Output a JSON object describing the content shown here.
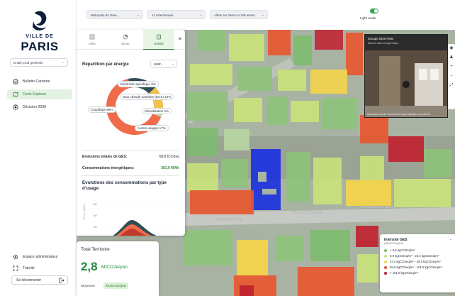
{
  "logo": {
    "line1": "VILLE DE",
    "line2": "PARIS"
  },
  "sidebar": {
    "entity": "Entité prod générale",
    "items": [
      {
        "label": "Bulletin Carbone",
        "icon": "bulletin-icon"
      },
      {
        "label": "Carto Explorer",
        "icon": "map-icon",
        "active": true
      },
      {
        "label": "Décision 2030",
        "icon": "target-icon"
      }
    ],
    "admin": "Espace administrateur",
    "tutorial": "Tutoriel",
    "disconnect": "Se déconnecter"
  },
  "toolbar": {
    "scope": "Métropole du Gran...",
    "selection": "12 sélectionnés",
    "search": "Alban sur Seine et 149 autres",
    "light_mode": "Light mode",
    "light_on": true
  },
  "panel": {
    "tabs": [
      {
        "label": "Infos",
        "icon": "info-icon"
      },
      {
        "label": "Score",
        "icon": "score-icon"
      },
      {
        "label": "Détails",
        "icon": "details-icon",
        "active": true
      }
    ],
    "section_title": "Répartition par énergie",
    "unit": "MWh",
    "donut_labels": {
      "elec": "Electricité spécifique 3%",
      "ecs": "Eau chaude sanitaire (ECS) 14%",
      "chauffage": "Chauffage 66%",
      "clim": "Climatisation 1%",
      "autres": "Autres usages 17%"
    },
    "emissions_label": "Emissions totales de GES:",
    "emissions_value": "68,8 tCO2eq",
    "conso_label": "Consommations énergétiques:",
    "conso_value": "383,9 MWh",
    "evolution_title": "Evolutions des consommations par type d'usage",
    "mini_axis_label": "Conso. (MWh)"
  },
  "chart_data": {
    "type": "pie",
    "title": "Répartition par énergie",
    "categories": [
      "Chauffage",
      "Autres usages",
      "Eau chaude sanitaire (ECS)",
      "Electricité spécifique",
      "Climatisation"
    ],
    "values": [
      66,
      17,
      14,
      3,
      1
    ],
    "unit": "%",
    "colors": [
      "#ef6b4a",
      "#2e4d57",
      "#f2c14e",
      "#7cc38a",
      "#b7d9c0"
    ]
  },
  "mini_chart": {
    "ticks": [
      "60",
      "40",
      "20"
    ]
  },
  "total": {
    "title": "Total Territoire",
    "value": "2,8",
    "unit": "MtCO2eq/an",
    "mean_label": "Moyenne",
    "mean_value": "39,6tCO2eq/an"
  },
  "map": {
    "street1": "Rue Alexandre Parodi",
    "street2": "Rue Alexandre Parodi",
    "street3": "e Alexandre Parodi",
    "streetview": {
      "title": "Groupe GES Paris",
      "subtitle": "Afficher dans Google Maps",
      "footer": "Raccourcis clavier   Données d'images   Signaler un problème"
    },
    "legend": {
      "title": "Intensité GES",
      "subtitle": "(tMtotCO2eq/m²)",
      "rows": [
        {
          "label": "< 8,9 kgCO2eq/m²",
          "color": "#7dbb6e"
        },
        {
          "label": "8,9 kgCO2eq/m² - 24,4 kgCO2eq/m²",
          "color": "#c9e27a"
        },
        {
          "label": "24,4 kgCO2eq/m² - 38,0 kgCO2eq/m²",
          "color": "#f3d44c"
        },
        {
          "label": "38,0 kgCO2eq/m² - 101,8 kgCO2eq/m²",
          "color": "#e8552f"
        },
        {
          "label": "> 101,8 kgCO2eq/m²",
          "color": "#c01f2f"
        }
      ]
    }
  }
}
